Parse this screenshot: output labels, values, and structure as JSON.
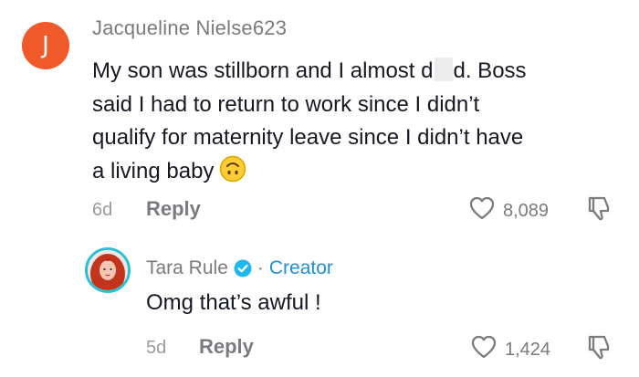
{
  "comment": {
    "avatar_letter": "J",
    "avatar_color": "#f0592a",
    "username": "Jacqueline Nielse623",
    "line1_before_censor": "My son was stillborn and I almost d",
    "line1_after_censor": "d. Boss",
    "line2": "said I had to return to work since I didn’t",
    "line3": "qualify for maternity leave since I didn’t have",
    "line4": "a living baby",
    "emoji": "upside-down-face-emoji",
    "age": "6d",
    "reply_label": "Reply",
    "likes": "8,089"
  },
  "reply": {
    "username": "Tara Rule",
    "verified_icon": "verified-badge-icon",
    "separator": "·",
    "role": "Creator",
    "role_color": "#1e8fd8",
    "text": "Omg that’s awful !",
    "age": "5d",
    "reply_label": "Reply",
    "likes": "1,424"
  }
}
